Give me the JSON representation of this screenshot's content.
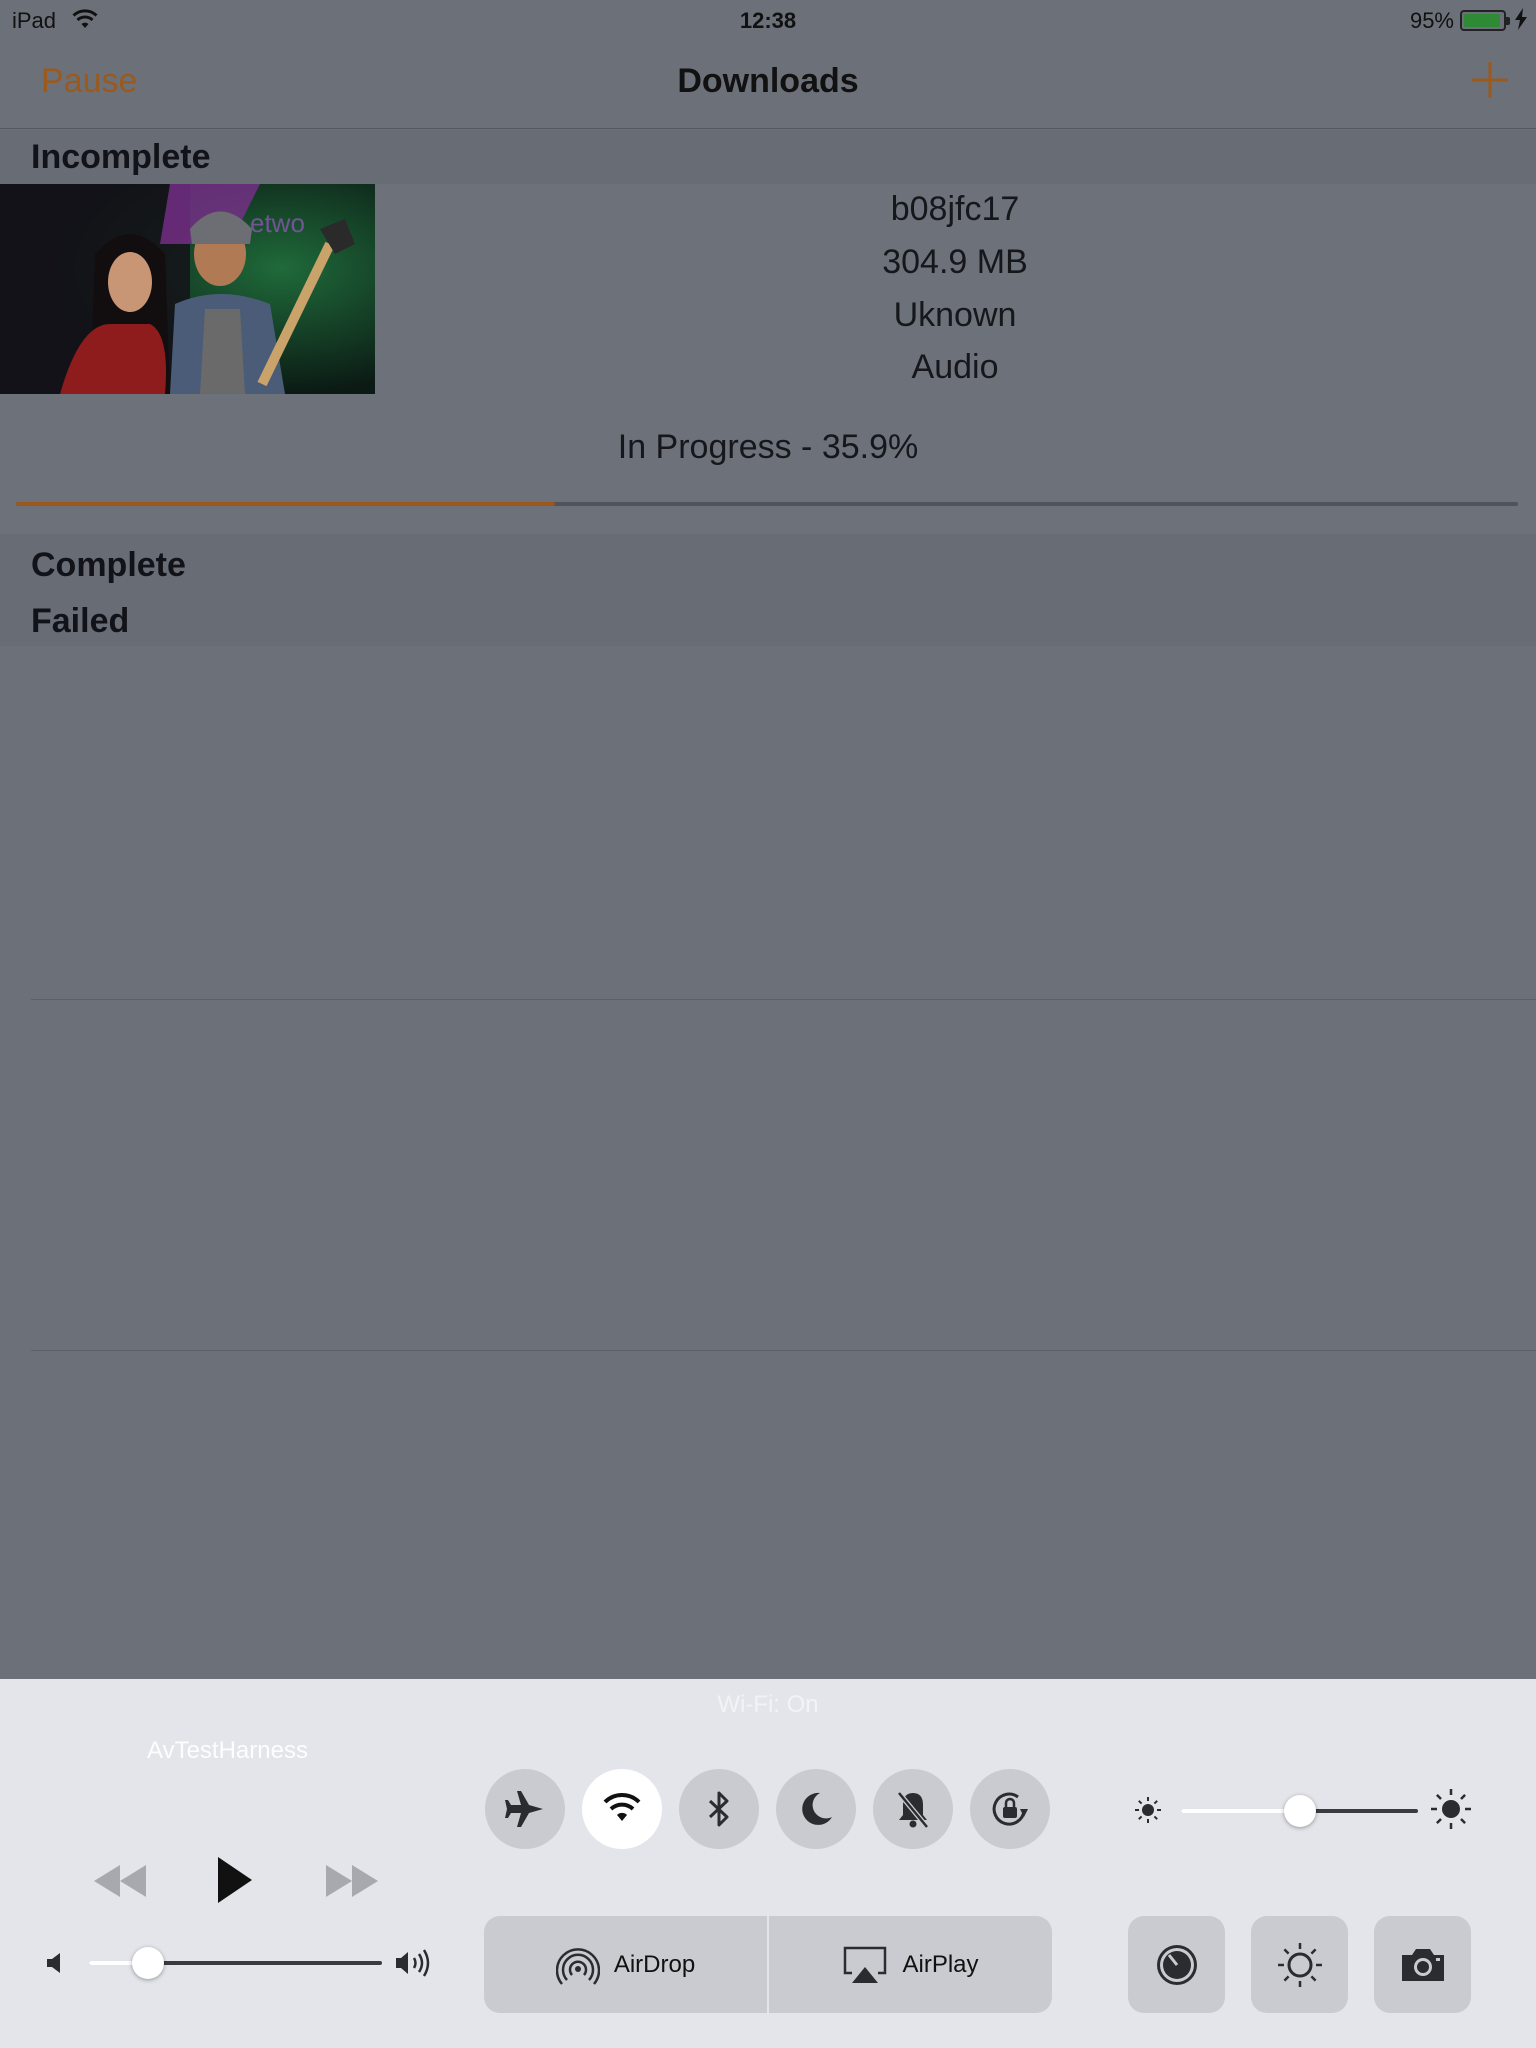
{
  "status_bar": {
    "device": "iPad",
    "time": "12:38",
    "battery_percent": "95%"
  },
  "nav": {
    "left_button": "Pause",
    "title": "Downloads",
    "add_icon": "plus-icon"
  },
  "sections": {
    "incomplete": "Incomplete",
    "complete": "Complete",
    "failed": "Failed"
  },
  "download": {
    "name": "b08jfc17",
    "size": "304.9 MB",
    "length": "Uknown",
    "type": "Audio",
    "status": "In Progress - 35.9%",
    "progress": 0.359
  },
  "control_center": {
    "hint": "Wi-Fi: On",
    "now_playing_app": "AvTestHarness",
    "volume_level": 0.2,
    "brightness_level": 0.5,
    "toggles": [
      {
        "name": "airplane-mode",
        "icon": "airplane-icon",
        "on": false
      },
      {
        "name": "wifi",
        "icon": "wifi-icon",
        "on": true
      },
      {
        "name": "bluetooth",
        "icon": "bluetooth-icon",
        "on": false
      },
      {
        "name": "do-not-disturb",
        "icon": "moon-icon",
        "on": false
      },
      {
        "name": "mute",
        "icon": "bell-slash-icon",
        "on": false
      },
      {
        "name": "rotation-lock",
        "icon": "rotation-lock-icon",
        "on": false
      }
    ],
    "airdrop_label": "AirDrop",
    "airplay_label": "AirPlay",
    "tools": [
      "timer-icon",
      "night-shift-icon",
      "camera-icon"
    ]
  },
  "colors": {
    "accent": "#9a5a1d",
    "progress_fill": "#9c571c",
    "battery": "#2e8a35",
    "dim_background": "#6c7079"
  }
}
